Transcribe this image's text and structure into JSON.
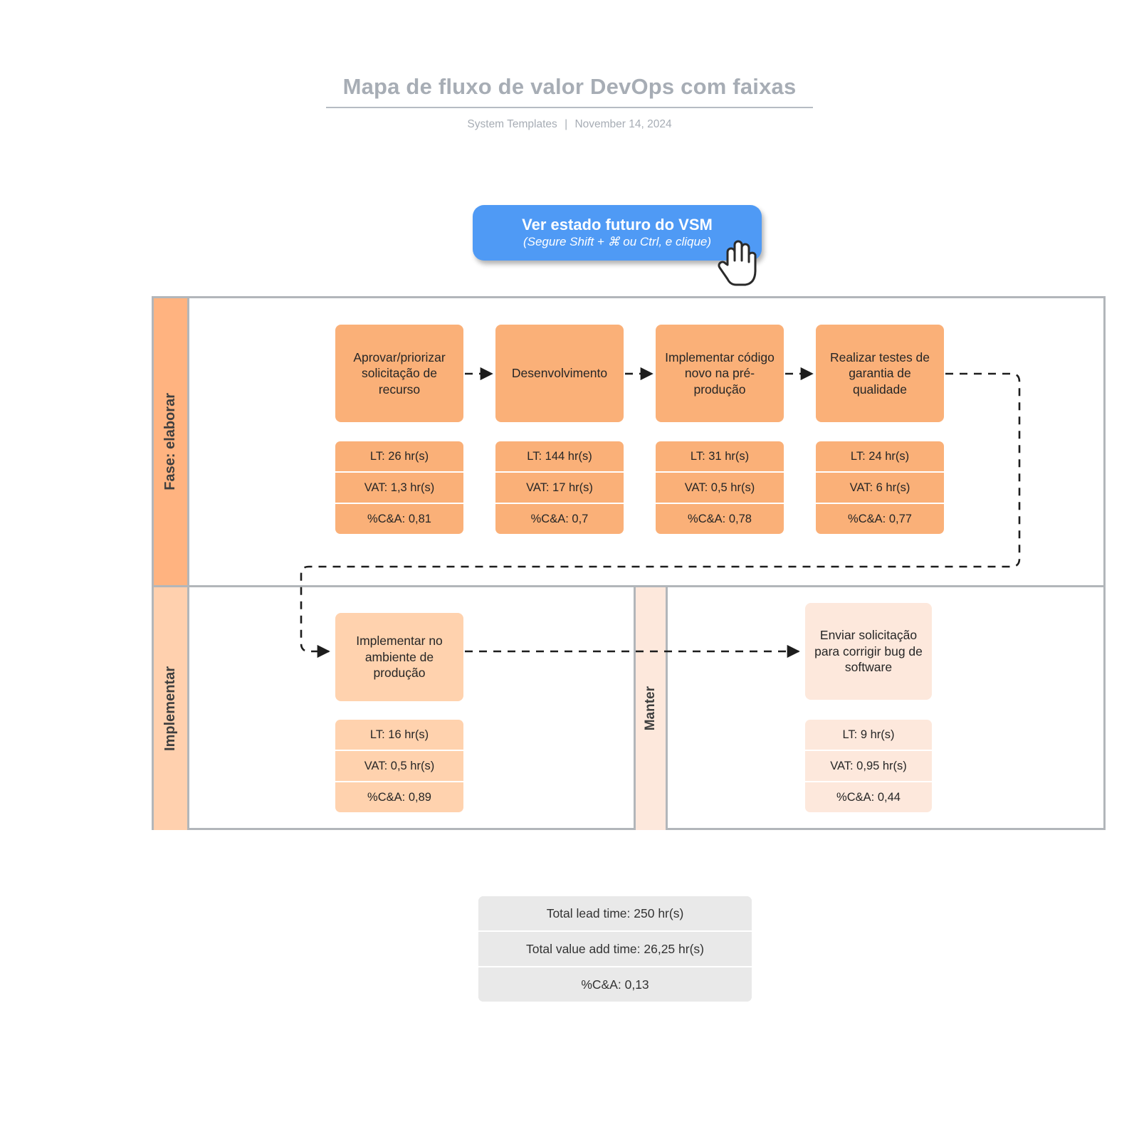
{
  "header": {
    "title": "Mapa de fluxo de valor DevOps com faixas",
    "author": "System Templates",
    "separator": "|",
    "date": "November 14, 2024"
  },
  "cta": {
    "label": "Ver estado futuro do VSM",
    "hint": "(Segure Shift + ⌘ ou Ctrl, e clique)",
    "color": "#4f9af5",
    "icon": "pointing-hand-cursor"
  },
  "lanes": [
    {
      "id": "build",
      "label": "Fase: elaborar",
      "band_color": "#ffb380",
      "node_color": "#fab078"
    },
    {
      "id": "deploy",
      "label": "Implementar",
      "band_color": "#ffd0ae",
      "node_color": "#ffd2ae"
    }
  ],
  "sublane": {
    "id": "manter",
    "label": "Manter",
    "band_color": "#fde8dc",
    "node_color": "#fde8dc"
  },
  "metric_labels": {
    "lt": "LT:",
    "vat": "VAT:",
    "ca": "%C&A:"
  },
  "nodes": [
    {
      "id": "approve",
      "lane": "build",
      "label": "Aprovar/priorizar solicitação de recurso",
      "lt": "LT:  26 hr(s)",
      "vat": "VAT:  1,3 hr(s)",
      "ca": "%C&A: 0,81"
    },
    {
      "id": "develop",
      "lane": "build",
      "label": "Desenvolvimento",
      "lt": "LT:  144 hr(s)",
      "vat": "VAT:  17 hr(s)",
      "ca": "%C&A: 0,7"
    },
    {
      "id": "deploy-preprod",
      "lane": "build",
      "label": "Implementar código novo na pré-produção",
      "lt": "LT:  31 hr(s)",
      "vat": "VAT:  0,5 hr(s)",
      "ca": "%C&A: 0,78"
    },
    {
      "id": "qa",
      "lane": "build",
      "label": "Realizar testes de garantia de qualidade",
      "lt": "LT:  24 hr(s)",
      "vat": "VAT:  6 hr(s)",
      "ca": "%C&A: 0,77"
    },
    {
      "id": "deploy-prod",
      "lane": "deploy",
      "label": "Implementar no ambiente de produção",
      "lt": "LT:  16 hr(s)",
      "vat": "VAT:  0,5 hr(s)",
      "ca": "%C&A: 0,89"
    },
    {
      "id": "bugfix",
      "lane": "manter",
      "label": "Enviar solicitação para corrigir bug de software",
      "lt": "LT:  9 hr(s)",
      "vat": "VAT:  0,95 hr(s)",
      "ca": "%C&A: 0,44"
    }
  ],
  "totals": {
    "lead_time": "Total lead time:  250 hr(s)",
    "value_add_time": "Total value add time: 26,25 hr(s)",
    "ca": "%C&A: 0,13"
  }
}
